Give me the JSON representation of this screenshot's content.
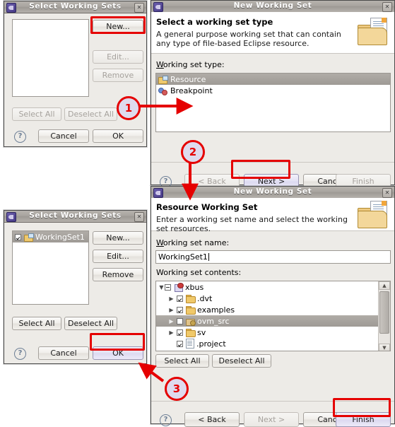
{
  "accent": {
    "highlight_red": "#e50000",
    "callout_fill": "#dedbee",
    "dialog_bg": "#edebe7",
    "selection_gray": "#a8a49f"
  },
  "dialog_select_ws_top": {
    "title": "Select Working Sets",
    "close_glyph": "✕",
    "list_items": [],
    "buttons": {
      "new": "New...",
      "edit": "Edit...",
      "remove": "Remove",
      "select_all": "Select All",
      "deselect_all": "Deselect All",
      "cancel": "Cancel",
      "ok": "OK"
    },
    "help_glyph": "?"
  },
  "dialog_new_ws_type": {
    "title": "New Working Set",
    "close_glyph": "✕",
    "heading": "Select a working set type",
    "description": "A general purpose working set that can contain any type of file-based Eclipse resource.",
    "list_label": "Working set type:",
    "list_label_mnemonic": "W",
    "items": [
      {
        "label": "Resource",
        "icon": "working-set-icon",
        "selected": true
      },
      {
        "label": "Breakpoint",
        "icon": "breakpoint-icon",
        "selected": false
      }
    ],
    "buttons": {
      "back": "< Back",
      "next": "Next >",
      "cancel": "Cancel",
      "finish": "Finish"
    },
    "help_glyph": "?"
  },
  "dialog_resource_ws": {
    "title": "New Working Set",
    "close_glyph": "✕",
    "heading": "Resource Working Set",
    "description": "Enter a working set name and select the working set resources.",
    "name_label": "Working set name:",
    "name_value": "WorkingSet1",
    "contents_label": "Working set contents:",
    "tree": [
      {
        "label": "xbus",
        "icon": "project-icon",
        "depth": 0,
        "twisty": "expanded",
        "check": "partial",
        "selected": false
      },
      {
        "label": ".dvt",
        "icon": "folder-icon",
        "depth": 1,
        "twisty": "collapsed",
        "check": "checked",
        "selected": false
      },
      {
        "label": "examples",
        "icon": "folder-icon",
        "depth": 1,
        "twisty": "collapsed",
        "check": "checked",
        "selected": false
      },
      {
        "label": "ovm_src",
        "icon": "linked-folder-icon",
        "depth": 1,
        "twisty": "collapsed",
        "check": "unchecked",
        "selected": true
      },
      {
        "label": "sv",
        "icon": "folder-icon",
        "depth": 1,
        "twisty": "collapsed",
        "check": "checked",
        "selected": false
      },
      {
        "label": ".project",
        "icon": "file-icon",
        "depth": 2,
        "twisty": "none",
        "check": "checked",
        "selected": false
      }
    ],
    "buttons": {
      "select_all": "Select All",
      "deselect_all": "Deselect All",
      "back": "< Back",
      "next": "Next >",
      "cancel": "Cancel",
      "finish": "Finish"
    },
    "help_glyph": "?"
  },
  "dialog_select_ws_bottom": {
    "title": "Select Working Sets",
    "close_glyph": "✕",
    "list_items": [
      {
        "label": "WorkingSet1",
        "checked": true,
        "selected": true,
        "icon": "working-set-icon"
      }
    ],
    "buttons": {
      "new": "New...",
      "edit": "Edit...",
      "remove": "Remove",
      "select_all": "Select All",
      "deselect_all": "Deselect All",
      "cancel": "Cancel",
      "ok": "OK"
    },
    "help_glyph": "?"
  },
  "callouts": [
    {
      "number": "1"
    },
    {
      "number": "2"
    },
    {
      "number": "3"
    }
  ]
}
